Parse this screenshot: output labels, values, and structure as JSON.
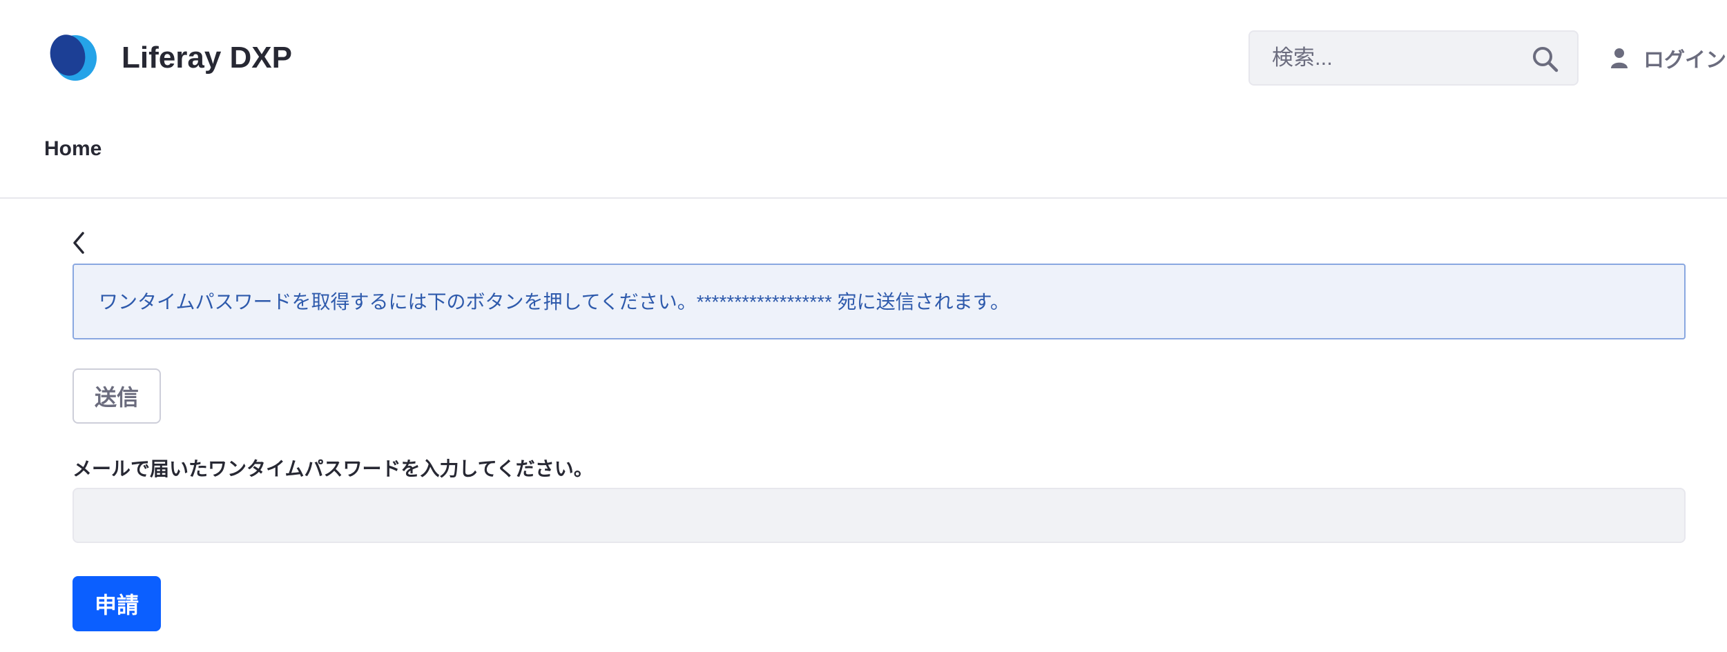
{
  "header": {
    "site_name": "Liferay DXP",
    "logo_icon": "liferay-logo-icon",
    "search": {
      "placeholder": "検索...",
      "value": "",
      "icon": "search-icon"
    },
    "login": {
      "icon": "user-icon",
      "label": "ログイン"
    }
  },
  "nav": {
    "items": [
      {
        "label": "Home"
      }
    ]
  },
  "main": {
    "back_icon": "chevron-left-icon",
    "alert": {
      "text": "ワンタイムパスワードを取得するには下のボタンを押してください。****************** 宛に送信されます。"
    },
    "send_button": {
      "label": "送信"
    },
    "otp_field": {
      "label": "メールで届いたワンタイムパスワードを入力してください。",
      "value": ""
    },
    "apply_button": {
      "label": "申請"
    }
  },
  "colors": {
    "brand_dark": "#1c3f95",
    "brand_light": "#25a3e8",
    "primary": "#0b5fff",
    "info_text": "#2e5aac",
    "info_bg": "#eef2fa",
    "info_border": "#89a7e0"
  }
}
